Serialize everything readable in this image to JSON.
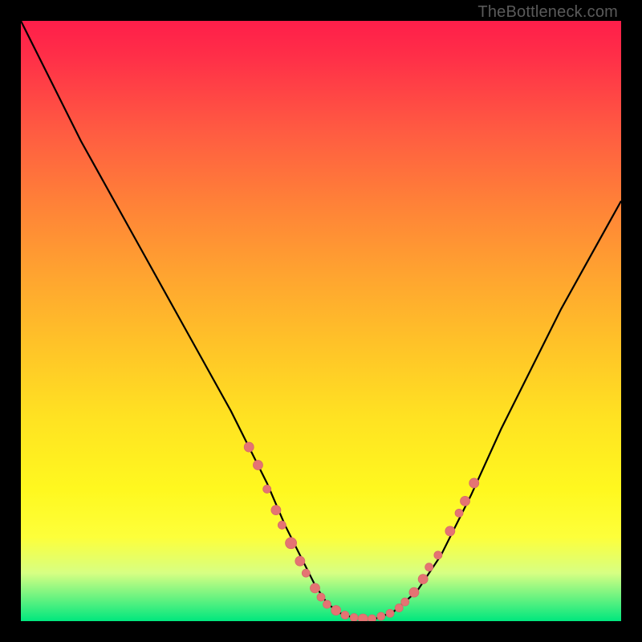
{
  "attribution": "TheBottleneck.com",
  "colors": {
    "frame": "#000000",
    "curve": "#000000",
    "marker_fill": "#e57373",
    "marker_stroke": "#d46a6a",
    "gradient_top": "#ff1e4a",
    "gradient_bottom": "#00e77e"
  },
  "chart_data": {
    "type": "line",
    "title": "",
    "xlabel": "",
    "ylabel": "",
    "xlim": [
      0,
      100
    ],
    "ylim": [
      0,
      100
    ],
    "series": [
      {
        "name": "curve",
        "x": [
          0,
          5,
          10,
          15,
          20,
          25,
          30,
          35,
          38,
          41,
          44,
          47,
          49,
          51,
          53,
          55,
          57,
          59,
          62,
          66,
          70,
          75,
          80,
          85,
          90,
          95,
          100
        ],
        "y": [
          100,
          90,
          80,
          71,
          62,
          53,
          44,
          35,
          29,
          23,
          16,
          10,
          6,
          3,
          1.4,
          0.7,
          0.4,
          0.4,
          1.5,
          5,
          11,
          21,
          32,
          42,
          52,
          61,
          70
        ]
      }
    ],
    "markers": [
      {
        "x": 38,
        "y": 29,
        "r": 6
      },
      {
        "x": 39.5,
        "y": 26,
        "r": 6
      },
      {
        "x": 41,
        "y": 22,
        "r": 5
      },
      {
        "x": 42.5,
        "y": 18.5,
        "r": 6
      },
      {
        "x": 43.5,
        "y": 16,
        "r": 5
      },
      {
        "x": 45,
        "y": 13,
        "r": 7
      },
      {
        "x": 46.5,
        "y": 10,
        "r": 6
      },
      {
        "x": 47.5,
        "y": 8,
        "r": 5
      },
      {
        "x": 49,
        "y": 5.5,
        "r": 6
      },
      {
        "x": 50,
        "y": 4,
        "r": 5
      },
      {
        "x": 51,
        "y": 2.8,
        "r": 5
      },
      {
        "x": 52.5,
        "y": 1.8,
        "r": 6
      },
      {
        "x": 54,
        "y": 1.0,
        "r": 5
      },
      {
        "x": 55.5,
        "y": 0.6,
        "r": 5
      },
      {
        "x": 57,
        "y": 0.4,
        "r": 6
      },
      {
        "x": 58.5,
        "y": 0.4,
        "r": 5
      },
      {
        "x": 60,
        "y": 0.8,
        "r": 5
      },
      {
        "x": 61.5,
        "y": 1.3,
        "r": 5
      },
      {
        "x": 63,
        "y": 2.2,
        "r": 5
      },
      {
        "x": 64,
        "y": 3.2,
        "r": 5
      },
      {
        "x": 65.5,
        "y": 4.8,
        "r": 6
      },
      {
        "x": 67,
        "y": 7,
        "r": 6
      },
      {
        "x": 68,
        "y": 9,
        "r": 5
      },
      {
        "x": 69.5,
        "y": 11,
        "r": 5
      },
      {
        "x": 71.5,
        "y": 15,
        "r": 6
      },
      {
        "x": 73,
        "y": 18,
        "r": 5
      },
      {
        "x": 74,
        "y": 20,
        "r": 6
      },
      {
        "x": 75.5,
        "y": 23,
        "r": 6
      }
    ]
  }
}
